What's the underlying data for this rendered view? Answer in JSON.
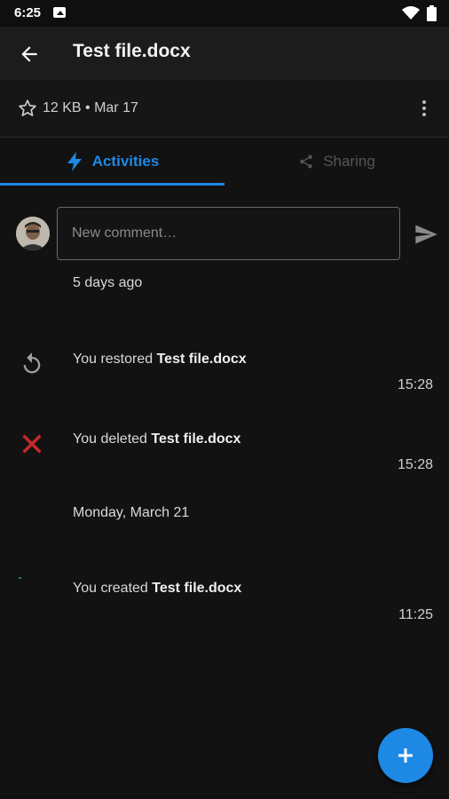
{
  "status_bar": {
    "time": "6:25"
  },
  "appbar": {
    "title": "Test file.docx"
  },
  "file_info": {
    "meta": "12 KB • Mar 17"
  },
  "tabs": [
    {
      "label": "Activities",
      "active": true
    },
    {
      "label": "Sharing",
      "active": false
    }
  ],
  "comment": {
    "placeholder": "New comment…"
  },
  "groups": [
    {
      "date": "5 days ago",
      "items": [
        {
          "prefix": "You restored ",
          "file": "Test file.docx",
          "time": "15:28",
          "icon": "restore-icon"
        },
        {
          "prefix": "You deleted ",
          "file": "Test file.docx",
          "time": "15:28",
          "icon": "delete-x-icon"
        }
      ]
    },
    {
      "date": "Monday, March 21",
      "items": [
        {
          "prefix": "You created ",
          "file": "Test file.docx",
          "time": "11:25",
          "icon": "created-icon"
        }
      ]
    }
  ],
  "colors": {
    "accent": "#1e88e5",
    "delete": "#c62828",
    "background": "#121212"
  }
}
